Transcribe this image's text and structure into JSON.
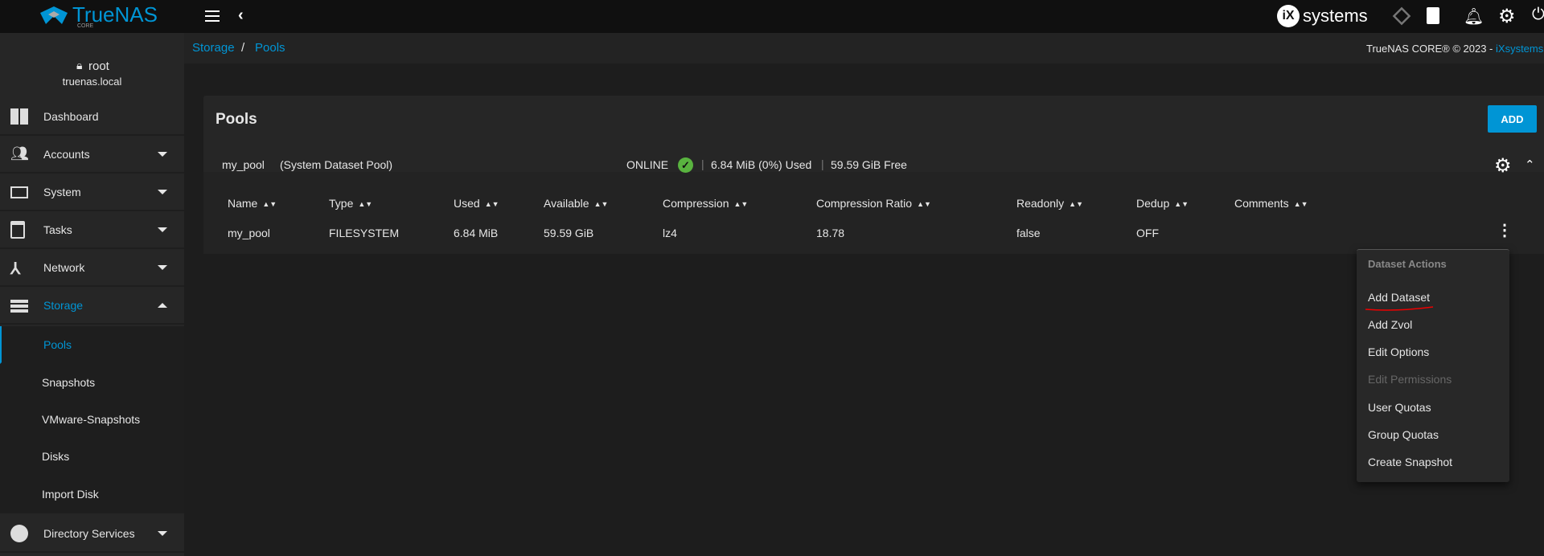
{
  "brand": {
    "name": "TrueNAS",
    "edition": "CORE"
  },
  "topbar": {
    "vendor": "systems",
    "icons": [
      "menu-icon",
      "back-icon",
      "truecommand-icon",
      "tasks-clipboard-icon",
      "bell-icon",
      "gear-icon",
      "power-icon"
    ]
  },
  "user": {
    "name": "root",
    "host": "truenas.local"
  },
  "sidebar": {
    "items": [
      {
        "label": "Dashboard",
        "icon": "dashboard-icon"
      },
      {
        "label": "Accounts",
        "icon": "accounts-icon"
      },
      {
        "label": "System",
        "icon": "laptop-icon"
      },
      {
        "label": "Tasks",
        "icon": "calendar-icon"
      },
      {
        "label": "Network",
        "icon": "network-icon"
      },
      {
        "label": "Storage",
        "icon": "storage-icon"
      },
      {
        "label": "Pools"
      },
      {
        "label": "Snapshots"
      },
      {
        "label": "VMware-Snapshots"
      },
      {
        "label": "Disks"
      },
      {
        "label": "Import Disk"
      },
      {
        "label": "Directory Services",
        "icon": "directory-icon"
      }
    ]
  },
  "breadcrumb": {
    "parent": "Storage",
    "sep": "/",
    "current": "Pools"
  },
  "copyright": {
    "text": "TrueNAS CORE® © 2023 - ",
    "link": "iXsystems"
  },
  "accent": "#0095d5",
  "card": {
    "title": "Pools",
    "add_label": "ADD"
  },
  "pool": {
    "name": "my_pool",
    "note": "(System Dataset Pool)",
    "status": "ONLINE",
    "used": "6.84 MiB (0%) Used",
    "free": "59.59 GiB Free"
  },
  "table": {
    "headers": [
      "Name",
      "Type",
      "Used",
      "Available",
      "Compression",
      "Compression Ratio",
      "Readonly",
      "Dedup",
      "Comments"
    ],
    "row": [
      "my_pool",
      "FILESYSTEM",
      "6.84 MiB",
      "59.59 GiB",
      "lz4",
      "18.78",
      "false",
      "OFF",
      ""
    ]
  },
  "menu": {
    "title": "Dataset Actions",
    "items": [
      "Add Dataset",
      "Add Zvol",
      "Edit Options",
      "Edit Permissions",
      "User Quotas",
      "Group Quotas",
      "Create Snapshot"
    ]
  }
}
